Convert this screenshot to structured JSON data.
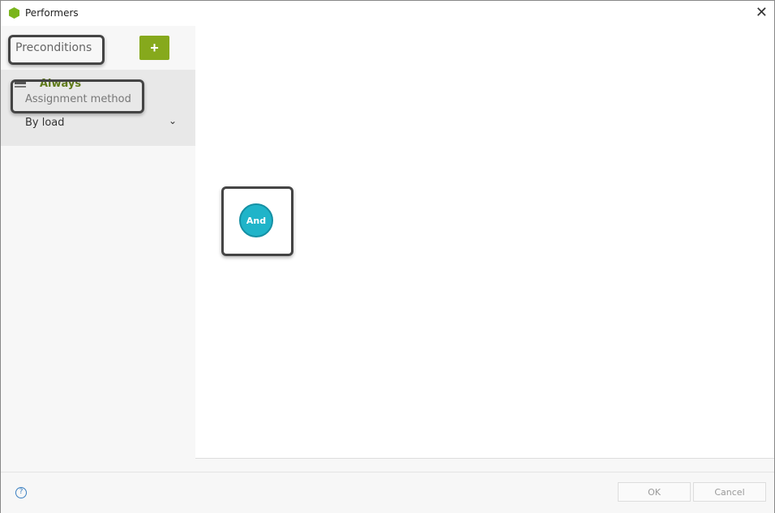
{
  "window": {
    "title": "Performers",
    "close_icon": "close-icon"
  },
  "sidebar": {
    "heading": "Preconditions",
    "add_label": "+",
    "items": [
      {
        "title": "Always",
        "label": "Assignment method",
        "value": "By load"
      }
    ]
  },
  "canvas": {
    "node_label": "And",
    "node_color": "#1fb4c9"
  },
  "footer": {
    "help": "?",
    "ok": "OK",
    "cancel": "Cancel"
  },
  "colors": {
    "accent": "#86a91c"
  }
}
